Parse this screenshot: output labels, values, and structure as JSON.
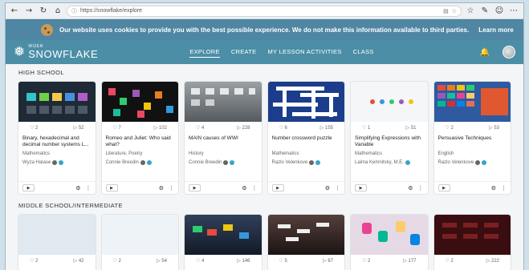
{
  "browser": {
    "url": "https://snowflake/explore",
    "icons": [
      "back-arrow-icon",
      "forward-arrow-icon",
      "refresh-icon",
      "home-icon",
      "star-icon",
      "extensions-icon",
      "profile-icon",
      "menu-icon"
    ]
  },
  "cookie_banner": {
    "message": "Our website uses cookies to provide you with the best possible experience. We do not make this information available to third parties.",
    "learn_more": "Learn more"
  },
  "site": {
    "logo_small": "WIZER",
    "logo_big": "SNOWFLAKE",
    "nav": [
      "EXPLORE",
      "CREATE",
      "MY LESSON ACTIVITIES",
      "CLASS"
    ],
    "active_nav": "EXPLORE"
  },
  "sections": [
    {
      "title": "HIGH SCHOOL",
      "cards": [
        {
          "likes": "2",
          "plays": "52",
          "title": "Binary, hexadecimal and decimal number systems L...",
          "subject": "Mathematics",
          "author": "Wyza Halase"
        },
        {
          "likes": "7",
          "plays": "102",
          "title": "Romeo and Juliet: Who said what?",
          "subject": "Literature, Poetry",
          "author": "Connie Breedin"
        },
        {
          "likes": "4",
          "plays": "228",
          "title": "MAIN causes of WWI",
          "subject": "History",
          "author": "Connie Breedin"
        },
        {
          "likes": "6",
          "plays": "155",
          "title": "Number crossword puzzle",
          "subject": "Mathematics",
          "author": "Razlo Velenkove"
        },
        {
          "likes": "1",
          "plays": "51",
          "title": "Simplifying Expressions with Variable",
          "subject": "Mathematics",
          "author": "Laima Kemnitsky, M.E."
        },
        {
          "likes": "2",
          "plays": "53",
          "title": "Persuasive Techniques",
          "subject": "English",
          "author": "Razlo Velenkove"
        }
      ]
    },
    {
      "title": "MIDDLE SCHOOL/INTERMEDIATE",
      "cards": [
        {
          "likes": "2",
          "plays": "42"
        },
        {
          "likes": "2",
          "plays": "54"
        },
        {
          "likes": "4",
          "plays": "146"
        },
        {
          "likes": "5",
          "plays": "67"
        },
        {
          "likes": "2",
          "plays": "177"
        },
        {
          "likes": "2",
          "plays": "222"
        }
      ]
    }
  ]
}
